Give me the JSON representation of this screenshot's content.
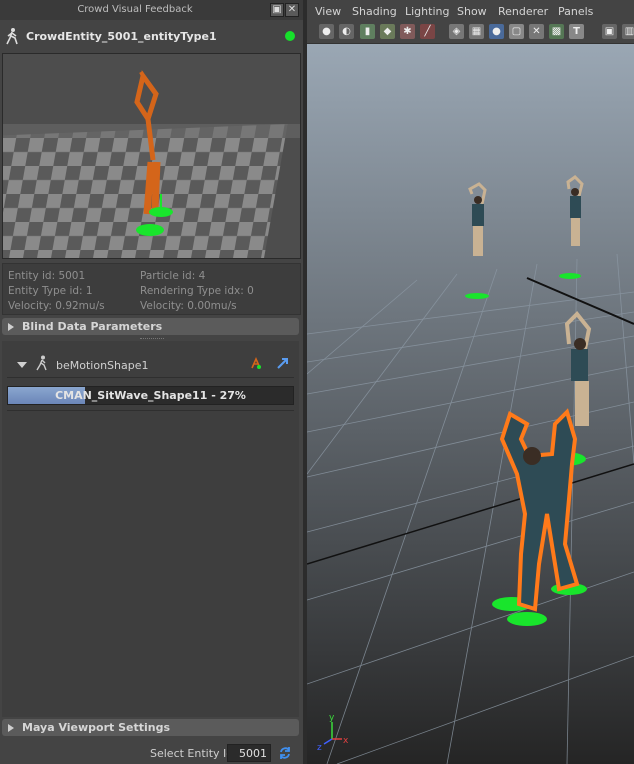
{
  "window": {
    "title": "Crowd Visual Feedback",
    "dock_icon": "dock-icon",
    "close_icon": "close-icon"
  },
  "entity": {
    "name": "CrowdEntity_5001_entityType1",
    "icon": "walking-man-icon",
    "status_color": "#17e02b"
  },
  "info": {
    "entity_id": "Entity id: 5001",
    "particle_id": "Particle id: 4",
    "entity_type_id": "Entity Type id: 1",
    "rendering_type_idx": "Rendering Type idx: 0",
    "velocity1": "Velocity: 0.92mu/s",
    "velocity2": "Velocity: 0.00mu/s"
  },
  "sections": {
    "blind_data": "Blind Data Parameters",
    "maya_viewport": "Maya Viewport Settings"
  },
  "motion": {
    "shape_name": "beMotionShape1",
    "clip_label": "CMAN_SitWave_Shape11 - 27%",
    "progress": 0.27
  },
  "select_entity": {
    "label": "Select Entity Id",
    "value": "5001"
  },
  "menu": [
    "View",
    "Shading",
    "Lighting",
    "Show",
    "Renderer",
    "Panels"
  ],
  "toolbar_icons": [
    "camera-icon",
    "camera-attr-icon",
    "bookmark-icon",
    "image-plane-icon",
    "grid-icon",
    "film-gate-icon",
    "wireframe-icon",
    "resolution-gate-icon",
    "smooth-shade-icon",
    "flat-shade-icon",
    "xray-icon",
    "textured-icon",
    "text-icon",
    "cube-icon"
  ],
  "axis": {
    "y": "y",
    "x": "x",
    "z": "z"
  }
}
